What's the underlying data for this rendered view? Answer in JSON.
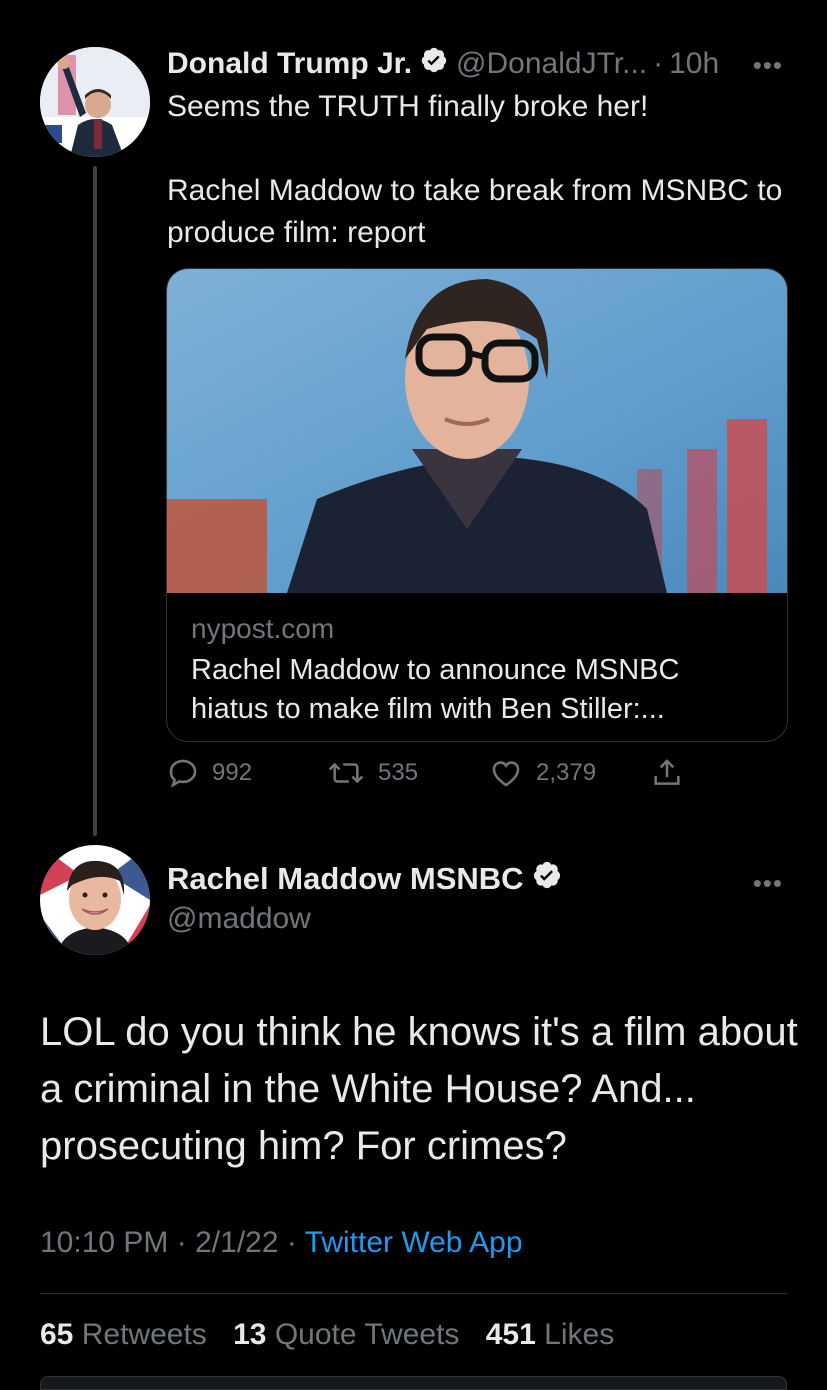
{
  "tweet1": {
    "author_name": "Donald Trump Jr.",
    "handle": "@DonaldJTr...",
    "separator": "·",
    "time": "10h",
    "more": "•••",
    "text_line1": "Seems the TRUTH finally broke her!",
    "text_line2": "Rachel Maddow to take break from MSNBC to produce film: report",
    "card": {
      "domain": "nypost.com",
      "title": "Rachel Maddow to announce MSNBC hiatus to make film with Ben Stiller:..."
    },
    "actions": {
      "replies": "992",
      "retweets": "535",
      "likes": "2,379"
    },
    "icons": [
      "verified-badge-icon",
      "reply-icon",
      "retweet-icon",
      "like-icon",
      "share-icon"
    ]
  },
  "tweet2": {
    "author_name": "Rachel Maddow MSNBC",
    "handle": "@maddow",
    "more": "•••",
    "text": "LOL do you think he knows it's a film about a criminal in the White House? And... prosecuting him? For crimes?",
    "time": "10:10 PM",
    "sep1": "·",
    "date": "2/1/22",
    "sep2": "·",
    "app": "Twitter Web App",
    "stats": {
      "retweets_count": "65",
      "retweets_label": "Retweets",
      "quotes_count": "13",
      "quotes_label": "Quote Tweets",
      "likes_count": "451",
      "likes_label": "Likes"
    }
  },
  "colors": {
    "background": "#000000",
    "text": "#e7e9ea",
    "muted": "#71767b",
    "link": "#1d9bf0",
    "border": "#2f3336"
  }
}
